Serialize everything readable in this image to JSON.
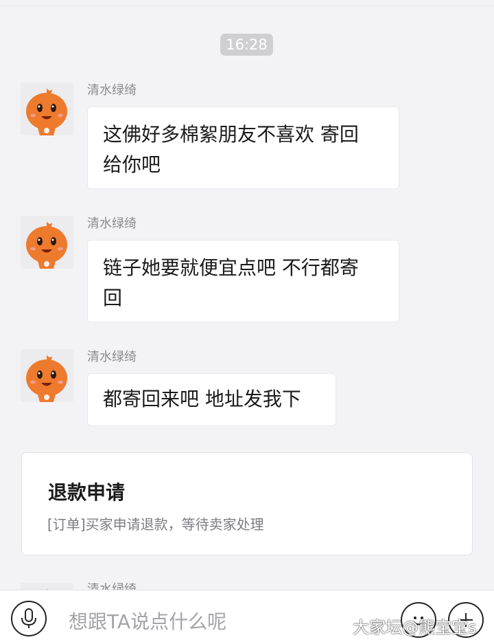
{
  "chat": {
    "timestamp": "16:28",
    "messages": [
      {
        "sender": "清水绿绮",
        "line1": "这佛好多棉絮朋友不喜欢 寄回",
        "line2": "给你吧"
      },
      {
        "sender": "清水绿绮",
        "line1": "链子她要就便宜点吧 不行都寄",
        "line2": "回"
      },
      {
        "sender": "清水绿绮",
        "line1": "都寄回来吧 地址发我下"
      }
    ],
    "partial_sender": "清水绿绮"
  },
  "refund_card": {
    "title": "退款申请",
    "description": "[订单]买家申请退款，等待卖家处理"
  },
  "input_bar": {
    "placeholder": "想跟TA说点什么呢",
    "left_icon": "microphone-icon",
    "right_icons": [
      "emoji-icon",
      "plus-icon"
    ]
  },
  "watermark": "大家坛@熊宝宝s",
  "colors": {
    "background": "#f3f3f5",
    "bubble": "#ffffff",
    "timestamp_pill": "#cfcfd3",
    "avatar_orange": "#ee7a2e"
  }
}
